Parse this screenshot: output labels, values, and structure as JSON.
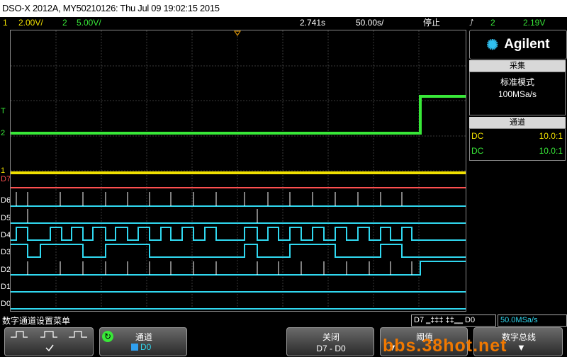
{
  "title_bar": {
    "text": "DSO-X 2012A, MY50210126: Thu Jul 09 19:02:15 2015"
  },
  "status": {
    "ch1_num": "1",
    "ch1_scale": "2.00V/",
    "ch2_num": "2",
    "ch2_scale": "5.00V/",
    "delay": "2.741s",
    "timebase": "50.00s/",
    "run_state": "停止",
    "trig_source": "2",
    "trig_level": "2.19V"
  },
  "channel_labels": [
    "T",
    "2",
    "1",
    "D7",
    "D6",
    "D5",
    "D4",
    "D3",
    "D2",
    "D1",
    "D0"
  ],
  "panel": {
    "brand": "Agilent",
    "acq_header": "采集",
    "acq_mode": "标准模式",
    "sample_rate": "100MSa/s",
    "chan_header": "通道",
    "ch1_coupling": "DC",
    "ch1_probe": "10.0:1",
    "ch2_coupling": "DC",
    "ch2_probe": "10.0:1"
  },
  "softkeys": {
    "menu_title": "数字通道设置菜单",
    "readout_digital": "D7 ‗‡‡‡ ‡‡‗‗ D0",
    "readout_rate": "50.0MSa/s",
    "channel_label": "通道",
    "channel_value": "D0",
    "close_label": "关闭",
    "close_value": "D7 - D0",
    "threshold_label": "阈值",
    "bus_label": "数字总线",
    "watermark": "bbs.38hot.net"
  },
  "colors": {
    "ch1": "#f0e000",
    "ch2": "#38e838",
    "digital": "#30d8f0",
    "d7": "#ff5050"
  }
}
